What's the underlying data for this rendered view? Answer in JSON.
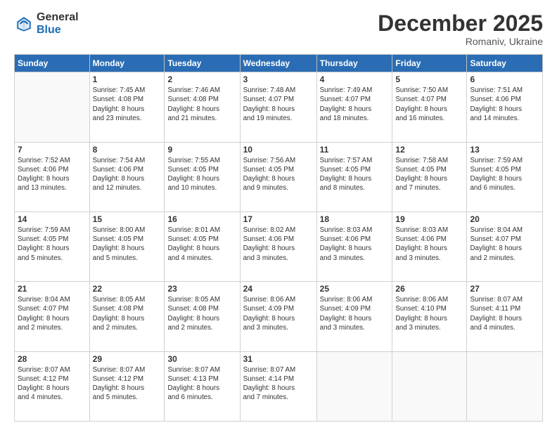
{
  "header": {
    "logo_general": "General",
    "logo_blue": "Blue",
    "month_title": "December 2025",
    "location": "Romaniv, Ukraine"
  },
  "days_of_week": [
    "Sunday",
    "Monday",
    "Tuesday",
    "Wednesday",
    "Thursday",
    "Friday",
    "Saturday"
  ],
  "weeks": [
    [
      {
        "day": null,
        "info": null
      },
      {
        "day": "1",
        "info": "Sunrise: 7:45 AM\nSunset: 4:08 PM\nDaylight: 8 hours\nand 23 minutes."
      },
      {
        "day": "2",
        "info": "Sunrise: 7:46 AM\nSunset: 4:08 PM\nDaylight: 8 hours\nand 21 minutes."
      },
      {
        "day": "3",
        "info": "Sunrise: 7:48 AM\nSunset: 4:07 PM\nDaylight: 8 hours\nand 19 minutes."
      },
      {
        "day": "4",
        "info": "Sunrise: 7:49 AM\nSunset: 4:07 PM\nDaylight: 8 hours\nand 18 minutes."
      },
      {
        "day": "5",
        "info": "Sunrise: 7:50 AM\nSunset: 4:07 PM\nDaylight: 8 hours\nand 16 minutes."
      },
      {
        "day": "6",
        "info": "Sunrise: 7:51 AM\nSunset: 4:06 PM\nDaylight: 8 hours\nand 14 minutes."
      }
    ],
    [
      {
        "day": "7",
        "info": "Sunrise: 7:52 AM\nSunset: 4:06 PM\nDaylight: 8 hours\nand 13 minutes."
      },
      {
        "day": "8",
        "info": "Sunrise: 7:54 AM\nSunset: 4:06 PM\nDaylight: 8 hours\nand 12 minutes."
      },
      {
        "day": "9",
        "info": "Sunrise: 7:55 AM\nSunset: 4:05 PM\nDaylight: 8 hours\nand 10 minutes."
      },
      {
        "day": "10",
        "info": "Sunrise: 7:56 AM\nSunset: 4:05 PM\nDaylight: 8 hours\nand 9 minutes."
      },
      {
        "day": "11",
        "info": "Sunrise: 7:57 AM\nSunset: 4:05 PM\nDaylight: 8 hours\nand 8 minutes."
      },
      {
        "day": "12",
        "info": "Sunrise: 7:58 AM\nSunset: 4:05 PM\nDaylight: 8 hours\nand 7 minutes."
      },
      {
        "day": "13",
        "info": "Sunrise: 7:59 AM\nSunset: 4:05 PM\nDaylight: 8 hours\nand 6 minutes."
      }
    ],
    [
      {
        "day": "14",
        "info": "Sunrise: 7:59 AM\nSunset: 4:05 PM\nDaylight: 8 hours\nand 5 minutes."
      },
      {
        "day": "15",
        "info": "Sunrise: 8:00 AM\nSunset: 4:05 PM\nDaylight: 8 hours\nand 5 minutes."
      },
      {
        "day": "16",
        "info": "Sunrise: 8:01 AM\nSunset: 4:05 PM\nDaylight: 8 hours\nand 4 minutes."
      },
      {
        "day": "17",
        "info": "Sunrise: 8:02 AM\nSunset: 4:06 PM\nDaylight: 8 hours\nand 3 minutes."
      },
      {
        "day": "18",
        "info": "Sunrise: 8:03 AM\nSunset: 4:06 PM\nDaylight: 8 hours\nand 3 minutes."
      },
      {
        "day": "19",
        "info": "Sunrise: 8:03 AM\nSunset: 4:06 PM\nDaylight: 8 hours\nand 3 minutes."
      },
      {
        "day": "20",
        "info": "Sunrise: 8:04 AM\nSunset: 4:07 PM\nDaylight: 8 hours\nand 2 minutes."
      }
    ],
    [
      {
        "day": "21",
        "info": "Sunrise: 8:04 AM\nSunset: 4:07 PM\nDaylight: 8 hours\nand 2 minutes."
      },
      {
        "day": "22",
        "info": "Sunrise: 8:05 AM\nSunset: 4:08 PM\nDaylight: 8 hours\nand 2 minutes."
      },
      {
        "day": "23",
        "info": "Sunrise: 8:05 AM\nSunset: 4:08 PM\nDaylight: 8 hours\nand 2 minutes."
      },
      {
        "day": "24",
        "info": "Sunrise: 8:06 AM\nSunset: 4:09 PM\nDaylight: 8 hours\nand 3 minutes."
      },
      {
        "day": "25",
        "info": "Sunrise: 8:06 AM\nSunset: 4:09 PM\nDaylight: 8 hours\nand 3 minutes."
      },
      {
        "day": "26",
        "info": "Sunrise: 8:06 AM\nSunset: 4:10 PM\nDaylight: 8 hours\nand 3 minutes."
      },
      {
        "day": "27",
        "info": "Sunrise: 8:07 AM\nSunset: 4:11 PM\nDaylight: 8 hours\nand 4 minutes."
      }
    ],
    [
      {
        "day": "28",
        "info": "Sunrise: 8:07 AM\nSunset: 4:12 PM\nDaylight: 8 hours\nand 4 minutes."
      },
      {
        "day": "29",
        "info": "Sunrise: 8:07 AM\nSunset: 4:12 PM\nDaylight: 8 hours\nand 5 minutes."
      },
      {
        "day": "30",
        "info": "Sunrise: 8:07 AM\nSunset: 4:13 PM\nDaylight: 8 hours\nand 6 minutes."
      },
      {
        "day": "31",
        "info": "Sunrise: 8:07 AM\nSunset: 4:14 PM\nDaylight: 8 hours\nand 7 minutes."
      },
      {
        "day": null,
        "info": null
      },
      {
        "day": null,
        "info": null
      },
      {
        "day": null,
        "info": null
      }
    ]
  ]
}
